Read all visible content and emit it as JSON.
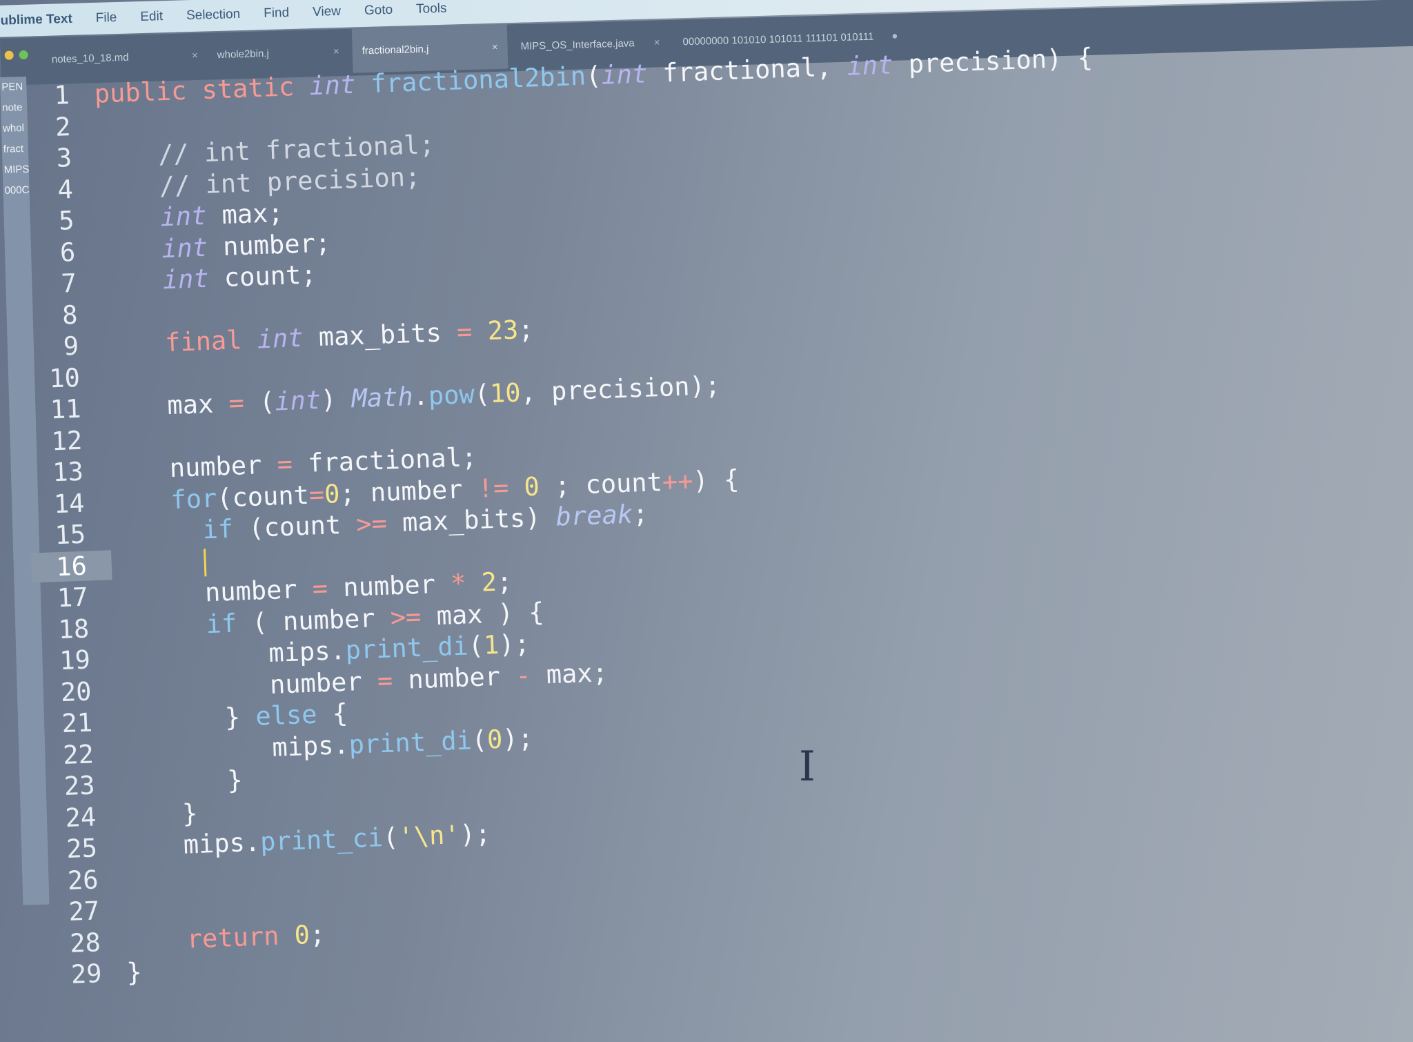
{
  "menubar": {
    "app_name": "ublime Text",
    "items": [
      "File",
      "Edit",
      "Selection",
      "Find",
      "View",
      "Goto",
      "Tools"
    ]
  },
  "tabs": [
    {
      "label": "notes_10_18.md",
      "active": false
    },
    {
      "label": "whole2bin.j",
      "active": false
    },
    {
      "label": "fractional2bin.j",
      "active": true
    },
    {
      "label": "MIPS_OS_Interface.java",
      "active": false
    },
    {
      "label": "00000000 101010 101011 111101 010111",
      "active": false
    }
  ],
  "sidebar": {
    "header": "PEN",
    "items": [
      "note",
      "whol",
      "fract",
      "MIPS",
      "000C"
    ]
  },
  "editor": {
    "current_line": 16,
    "lines": [
      {
        "n": "1",
        "tokens": [
          [
            "kw",
            "public static "
          ],
          [
            "ty",
            "int "
          ],
          [
            "fn",
            "fractional2bin"
          ],
          [
            "code",
            "("
          ],
          [
            "ty",
            "int"
          ],
          [
            "code",
            " fractional, "
          ],
          [
            "ty",
            "int"
          ],
          [
            "code",
            " precision) {"
          ]
        ]
      },
      {
        "n": "2",
        "tokens": []
      },
      {
        "n": "3",
        "tokens": [
          [
            "cm",
            "    // int fractional;"
          ]
        ]
      },
      {
        "n": "4",
        "tokens": [
          [
            "cm",
            "    // int precision;"
          ]
        ]
      },
      {
        "n": "5",
        "tokens": [
          [
            "ty",
            "    int"
          ],
          [
            "code",
            " max;"
          ]
        ]
      },
      {
        "n": "6",
        "tokens": [
          [
            "ty",
            "    int"
          ],
          [
            "code",
            " number;"
          ]
        ]
      },
      {
        "n": "7",
        "tokens": [
          [
            "ty",
            "    int"
          ],
          [
            "code",
            " count;"
          ]
        ]
      },
      {
        "n": "8",
        "tokens": []
      },
      {
        "n": "9",
        "tokens": [
          [
            "kw",
            "    final "
          ],
          [
            "ty",
            "int"
          ],
          [
            "code",
            " max_bits "
          ],
          [
            "op",
            "="
          ],
          [
            "code",
            " "
          ],
          [
            "num",
            "23"
          ],
          [
            "code",
            ";"
          ]
        ]
      },
      {
        "n": "10",
        "tokens": []
      },
      {
        "n": "11",
        "tokens": [
          [
            "code",
            "    max "
          ],
          [
            "op",
            "="
          ],
          [
            "code",
            " ("
          ],
          [
            "ty",
            "int"
          ],
          [
            "code",
            ") "
          ],
          [
            "cls",
            "Math"
          ],
          [
            "code",
            "."
          ],
          [
            "fn",
            "pow"
          ],
          [
            "code",
            "("
          ],
          [
            "num",
            "10"
          ],
          [
            "code",
            ", precision);"
          ]
        ]
      },
      {
        "n": "12",
        "tokens": []
      },
      {
        "n": "13",
        "tokens": [
          [
            "code",
            "    number "
          ],
          [
            "op",
            "="
          ],
          [
            "code",
            " fractional;"
          ]
        ]
      },
      {
        "n": "14",
        "tokens": [
          [
            "code",
            "    "
          ],
          [
            "fn",
            "for"
          ],
          [
            "code",
            "(count"
          ],
          [
            "op",
            "="
          ],
          [
            "num",
            "0"
          ],
          [
            "code",
            "; number "
          ],
          [
            "op",
            "!="
          ],
          [
            "code",
            " "
          ],
          [
            "num",
            "0"
          ],
          [
            "code",
            " ; count"
          ],
          [
            "op",
            "++"
          ],
          [
            "code",
            ") {"
          ]
        ]
      },
      {
        "n": "15",
        "tokens": [
          [
            "fn",
            "      if"
          ],
          [
            "code",
            " (count "
          ],
          [
            "op",
            ">="
          ],
          [
            "code",
            " max_bits) "
          ],
          [
            "cls",
            "break"
          ],
          [
            "code",
            ";"
          ]
        ]
      },
      {
        "n": "16",
        "tokens": [
          [
            "code",
            "      "
          ],
          [
            "caret",
            ""
          ]
        ]
      },
      {
        "n": "17",
        "tokens": [
          [
            "code",
            "      number "
          ],
          [
            "op",
            "="
          ],
          [
            "code",
            " number "
          ],
          [
            "op",
            "*"
          ],
          [
            "code",
            " "
          ],
          [
            "num",
            "2"
          ],
          [
            "code",
            ";"
          ]
        ]
      },
      {
        "n": "18",
        "tokens": [
          [
            "fn",
            "      if"
          ],
          [
            "code",
            " ( number "
          ],
          [
            "op",
            ">="
          ],
          [
            "code",
            " max ) {"
          ]
        ]
      },
      {
        "n": "19",
        "tokens": [
          [
            "code",
            "          mips."
          ],
          [
            "fn",
            "print_di"
          ],
          [
            "code",
            "("
          ],
          [
            "num",
            "1"
          ],
          [
            "code",
            ");"
          ]
        ]
      },
      {
        "n": "20",
        "tokens": [
          [
            "code",
            "          number "
          ],
          [
            "op",
            "="
          ],
          [
            "code",
            " number "
          ],
          [
            "op",
            "-"
          ],
          [
            "code",
            " max;"
          ]
        ]
      },
      {
        "n": "21",
        "tokens": [
          [
            "code",
            "       } "
          ],
          [
            "fn",
            "else"
          ],
          [
            "code",
            " {"
          ]
        ]
      },
      {
        "n": "22",
        "tokens": [
          [
            "code",
            "          mips."
          ],
          [
            "fn",
            "print_di"
          ],
          [
            "code",
            "("
          ],
          [
            "num",
            "0"
          ],
          [
            "code",
            ");"
          ]
        ]
      },
      {
        "n": "23",
        "tokens": [
          [
            "code",
            "       }"
          ]
        ]
      },
      {
        "n": "24",
        "tokens": [
          [
            "code",
            "    }"
          ]
        ]
      },
      {
        "n": "25",
        "tokens": [
          [
            "code",
            "    mips."
          ],
          [
            "fn",
            "print_ci"
          ],
          [
            "code",
            "("
          ],
          [
            "str",
            "'\\n'"
          ],
          [
            "code",
            ");"
          ]
        ]
      },
      {
        "n": "26",
        "tokens": []
      },
      {
        "n": "27",
        "tokens": []
      },
      {
        "n": "28",
        "tokens": [
          [
            "kw",
            "    return "
          ],
          [
            "num",
            "0"
          ],
          [
            "code",
            ";"
          ]
        ]
      },
      {
        "n": "29",
        "tokens": [
          [
            "code",
            "}"
          ]
        ]
      }
    ]
  },
  "icons": {
    "mouse_cursor": "text-cursor-icon"
  },
  "colors": {
    "background": "#7a8698",
    "keyword": "#f79a94",
    "type": "#b8b4f0",
    "function": "#8fc8ef",
    "number": "#f6e58a",
    "caret": "#f2d64c"
  }
}
